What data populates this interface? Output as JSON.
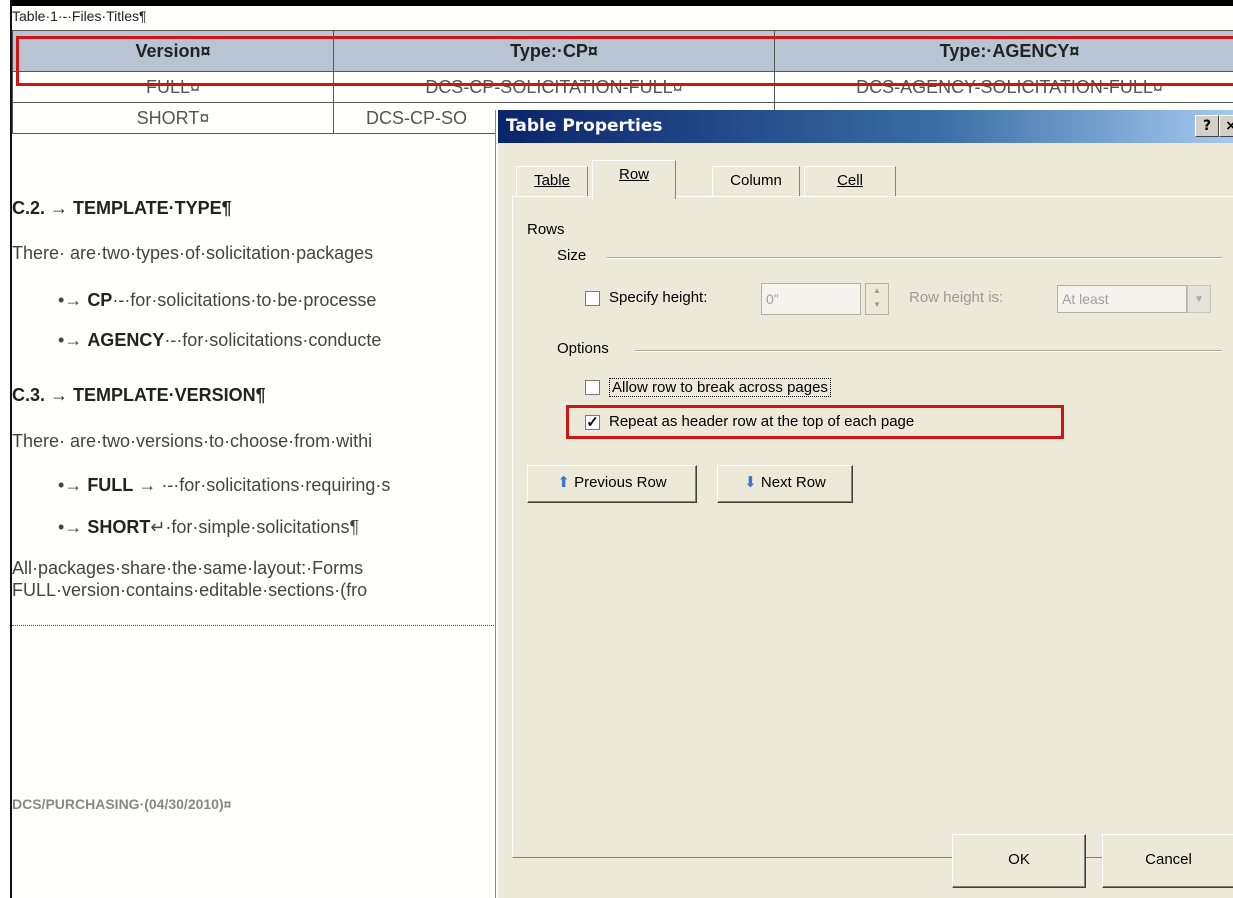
{
  "document": {
    "table_caption": "Table·1·-·Files·Titles¶",
    "table": {
      "headers": [
        "Version¤",
        "Type:·CP¤",
        "Type:·AGENCY¤"
      ],
      "rows": [
        [
          "FULL¤",
          "DCS-CP-SOLICITATION-FULL¤",
          "DCS-AGENCY-SOLICITATION-FULL¤"
        ],
        [
          "SHORT¤",
          "DCS-CP-SO",
          ""
        ]
      ]
    },
    "section_c2": "C.2.  →  TEMPLATE·TYPE¶",
    "para_c2": "There· are·two·types·of·solicitation·packages",
    "bullet_cp_term": "CP",
    "bullet_cp_text": "·-·for·solicitations·to·be·processe",
    "bullet_agency_term": "AGENCY",
    "bullet_agency_text": "·-·for·solicitations·conducte",
    "section_c3": "C.3.  →  TEMPLATE·VERSION¶",
    "para_c3": "There· are·two·versions·to·choose·from·withi",
    "bullet_full_term": "FULL",
    "bullet_full_text": "→ ·-·for·solicitations·requiring·s",
    "bullet_short_term": "SHORT",
    "bullet_short_text": "↵·for·simple·solicitations¶",
    "para_final_1": "All·packages·share·the·same·layout:·Forms",
    "para_final_2": "FULL·version·contains·editable·sections·(fro",
    "footer": "DCS/PURCHASING·(04/30/2010)¤"
  },
  "dialog": {
    "title": "Table Properties",
    "help_label": "?",
    "close_label": "×",
    "tabs": [
      "Table",
      "Row",
      "Column",
      "Cell"
    ],
    "active_tab": "Row",
    "rows_heading": "Rows",
    "size_heading": "Size",
    "specify_height_label": "Specify height:",
    "specify_height_checked": false,
    "height_value": "0\"",
    "row_height_is_label": "Row height is:",
    "row_height_is_value": "At least",
    "options_heading": "Options",
    "allow_break_label": "Allow row to break across pages",
    "allow_break_checked": false,
    "repeat_header_label": "Repeat as header row at the top of each page",
    "repeat_header_checked": true,
    "prev_row_label": "Previous Row",
    "next_row_label": "Next Row",
    "ok_label": "OK",
    "cancel_label": "Cancel"
  },
  "colors": {
    "highlight_box": "#d01515",
    "header_fill": "#b8c4d4",
    "dialog_bg": "#ece9d8"
  }
}
